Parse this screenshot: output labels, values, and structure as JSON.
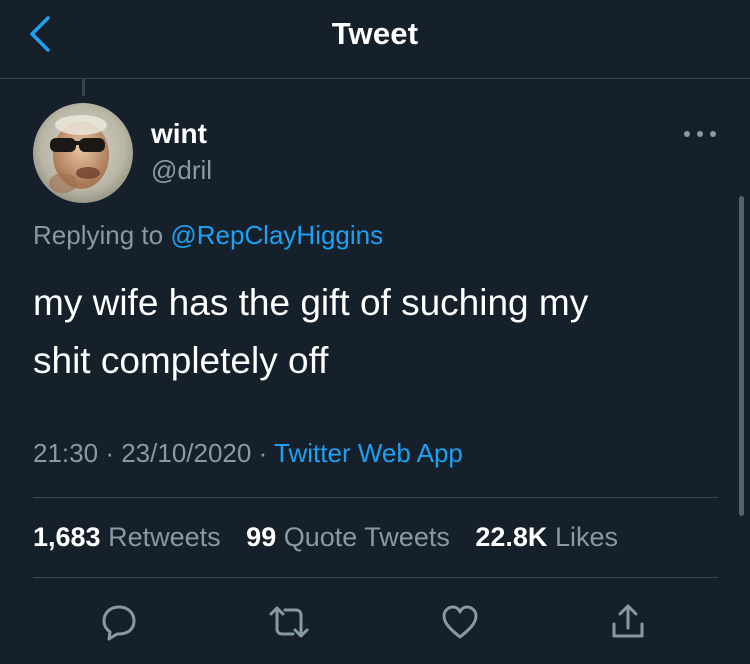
{
  "header": {
    "title": "Tweet",
    "back_icon": "chevron-left-icon"
  },
  "author": {
    "name": "wint",
    "handle": "@dril",
    "avatar_icon": "avatar-photo"
  },
  "tweet": {
    "replying_prefix": "Replying to",
    "replying_handle": "@RepClayHiggins",
    "text_line1": "my wife has the gift of suching my",
    "text_line2": "shit completely off"
  },
  "meta": {
    "time": "21:30",
    "sep1": "·",
    "date": "23/10/2020",
    "sep2": "·",
    "source": "Twitter Web App"
  },
  "stats": {
    "retweets_count": "1,683",
    "retweets_label": "Retweets",
    "quotes_count": "99",
    "quotes_label": "Quote Tweets",
    "likes_count": "22.8K",
    "likes_label": "Likes"
  },
  "actions": [
    "reply-icon",
    "retweet-icon",
    "like-icon",
    "share-icon"
  ],
  "colors": {
    "background": "#15202b",
    "text_primary": "#ffffff",
    "text_secondary": "#8899a6",
    "accent": "#1da1f2",
    "divider": "#38444d"
  }
}
